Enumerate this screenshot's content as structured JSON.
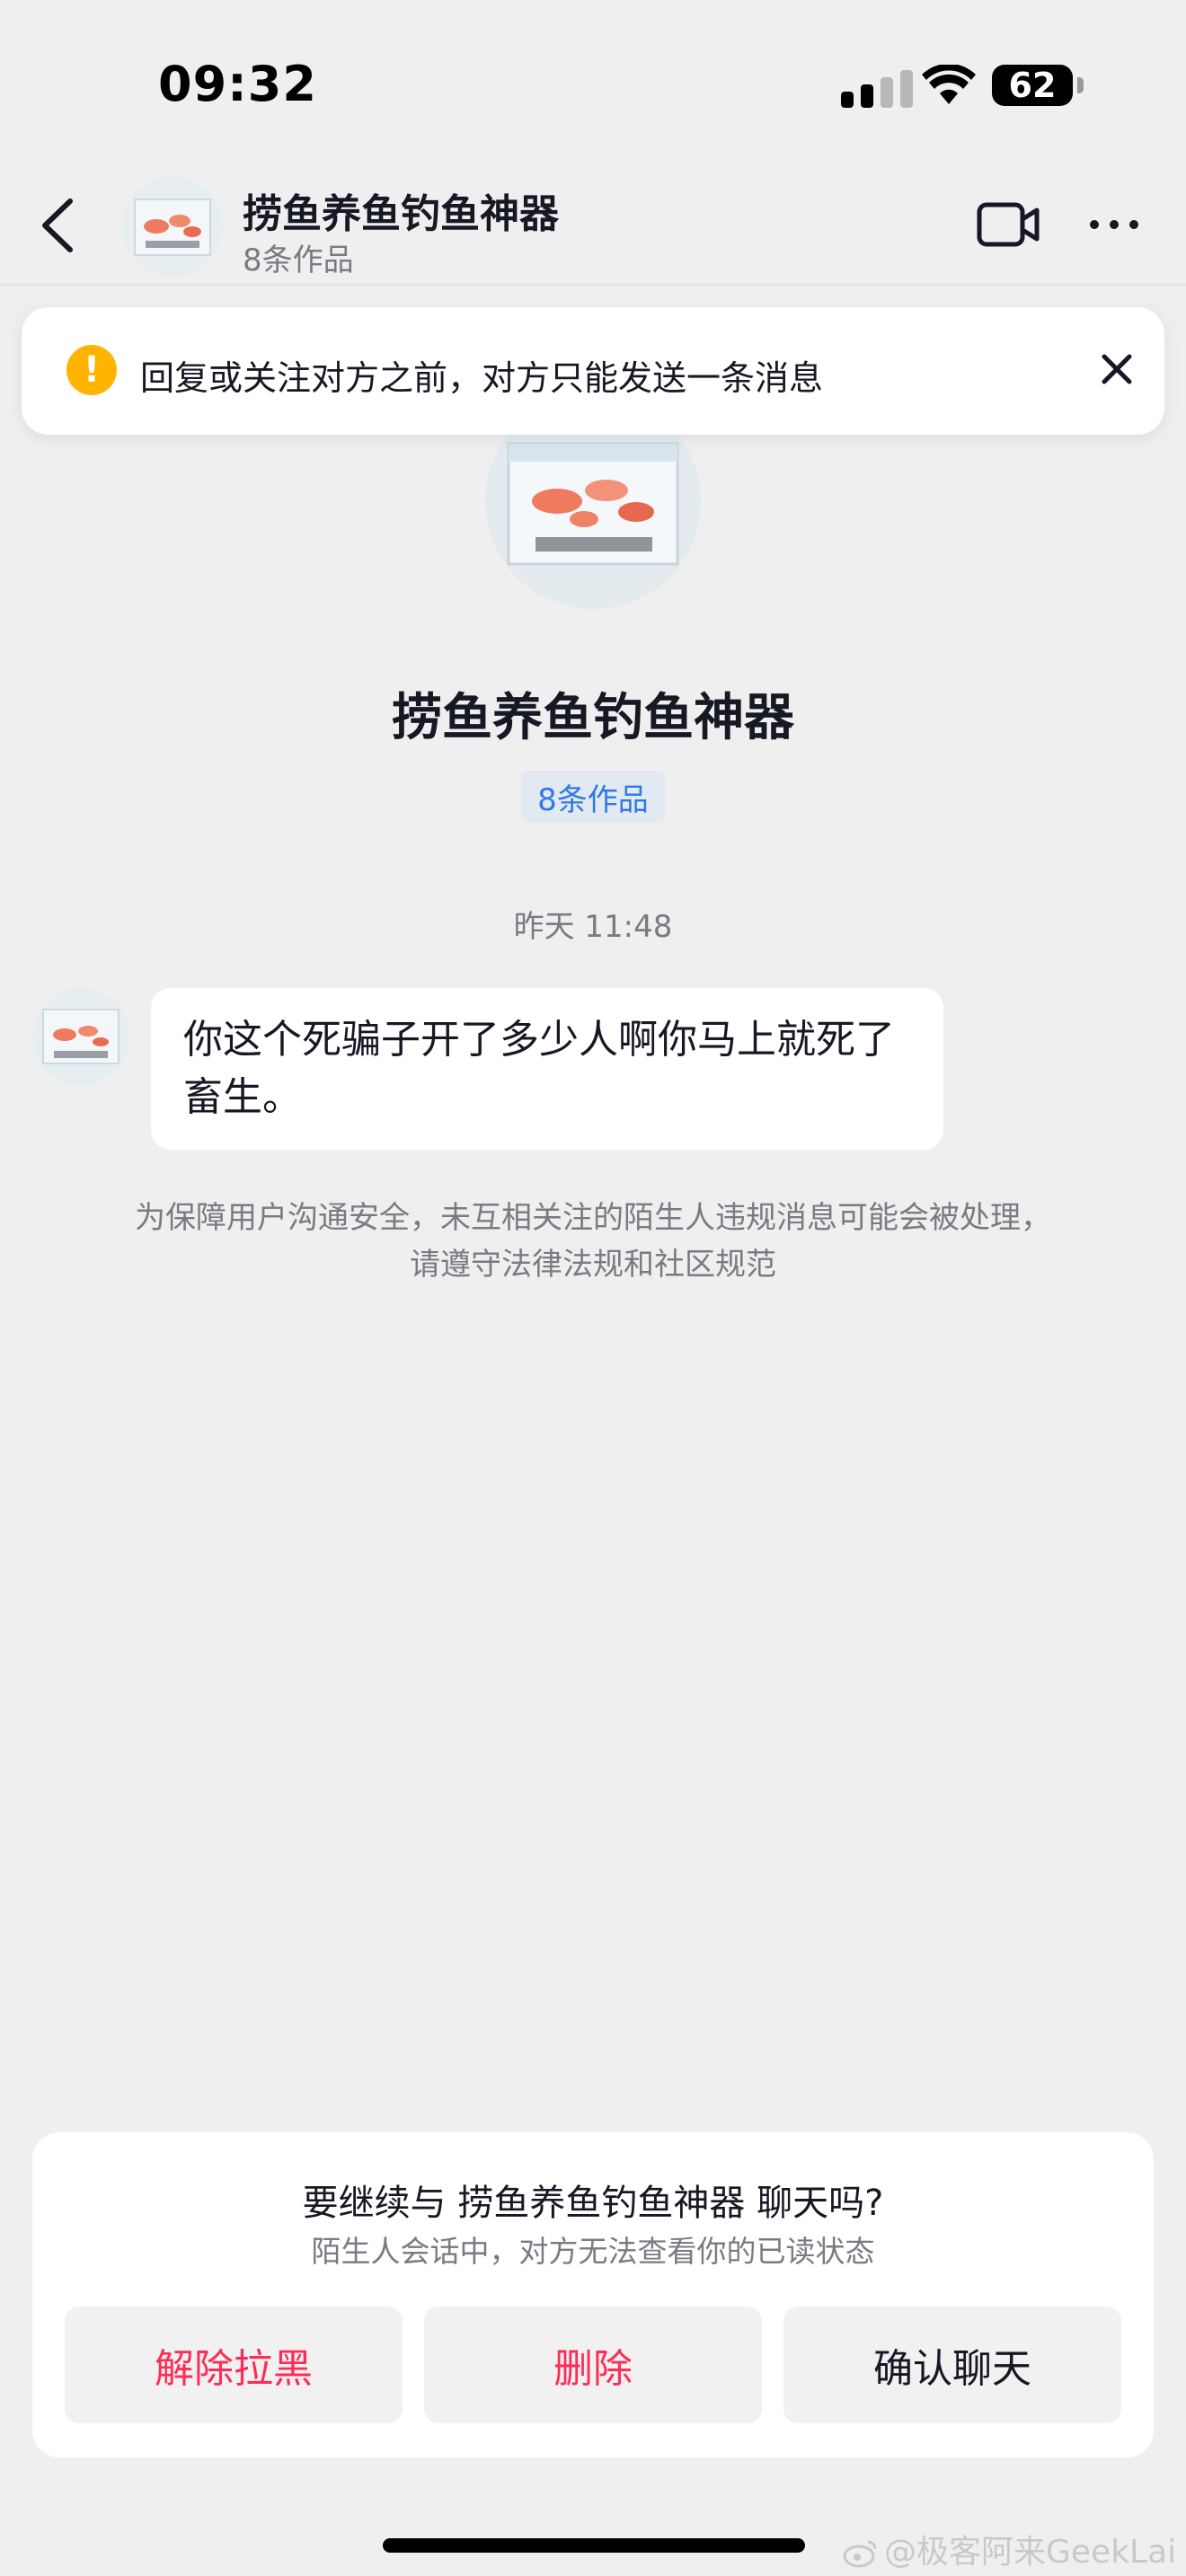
{
  "status_bar": {
    "time": "09:32",
    "battery": "62"
  },
  "header": {
    "name": "捞鱼养鱼钓鱼神器",
    "subtitle": "8条作品",
    "icons": [
      "back-icon",
      "video-call-icon",
      "more-icon"
    ]
  },
  "banner": {
    "text": "回复或关注对方之前，对方只能发送一条消息",
    "icon": "warning-icon",
    "colors": {
      "warning": "#ffb400"
    }
  },
  "profile": {
    "name": "捞鱼养鱼钓鱼神器",
    "works": "8条作品"
  },
  "chat": {
    "timestamp": "昨天 11:48",
    "message": "你这个死骗子开了多少人啊你马上就死了畜生。",
    "notice": "为保障用户沟通安全，未互相关注的陌生人违规消息可能会被处理，请遵守法律法规和社区规范"
  },
  "prompt": {
    "title": "要继续与 捞鱼养鱼钓鱼神器 聊天吗?",
    "subtitle": "陌生人会话中，对方无法查看你的已读状态",
    "buttons": {
      "unblock": "解除拉黑",
      "delete": "删除",
      "confirm": "确认聊天"
    },
    "colors": {
      "accent_red": "#fe2c55"
    }
  },
  "watermark": "@极客阿来GeekLai"
}
